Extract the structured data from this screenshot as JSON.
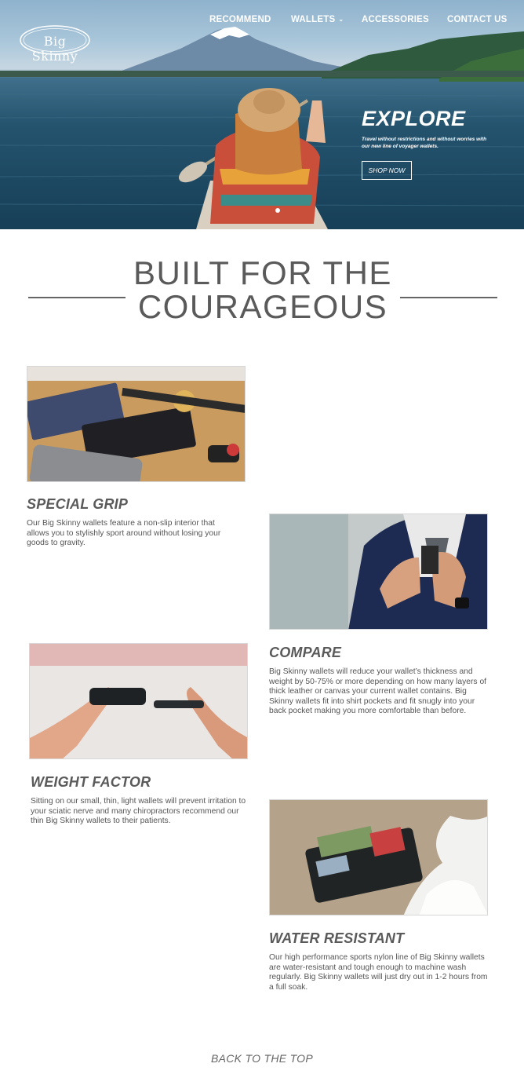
{
  "brand": {
    "logo_text": "Big Skinny"
  },
  "nav": {
    "items": [
      {
        "label": "RECOMMEND"
      },
      {
        "label": "WALLETS",
        "has_dropdown": true
      },
      {
        "label": "ACCESSORIES"
      },
      {
        "label": "CONTACT US"
      }
    ]
  },
  "hero": {
    "title": "EXPLORE",
    "subtitle": "Travel without restrictions and without worries with our new line of voyager wallets.",
    "cta": "SHOP NOW"
  },
  "section": {
    "headline_line1": "BUILT FOR THE",
    "headline_line2": "COURAGEOUS"
  },
  "features": [
    {
      "title": "SPECIAL GRIP",
      "body": "Our Big Skinny wallets feature a non-slip interior that allows you to stylishly sport around without losing your goods to gravity."
    },
    {
      "title": "COMPARE",
      "body": "Big Skinny wallets will reduce your wallet’s thickness and weight by 50-75% or more depending on how many layers of thick leather or canvas your current wallet contains. Big Skinny wallets fit into shirt pockets and fit snugly into your back pocket making you more comfortable than before."
    },
    {
      "title": "WEIGHT FACTOR",
      "body": "Sitting on our small, thin, light wallets will prevent irritation to your sciatic nerve and many chiropractors recommend our thin Big Skinny wallets to their patients."
    },
    {
      "title": "WATER RESISTANT",
      "body": "Our high performance sports nylon line of Big Skinny wallets are water-resistant and tough enough to machine wash regularly. Big Skinny wallets will just dry out in 1-2 hours from a full soak."
    }
  ],
  "footer": {
    "back_to_top": "BACK TO THE TOP"
  },
  "colors": {
    "heading": "#5a5a5a",
    "body_text": "#555555",
    "hero_water": "#1f4a64"
  }
}
